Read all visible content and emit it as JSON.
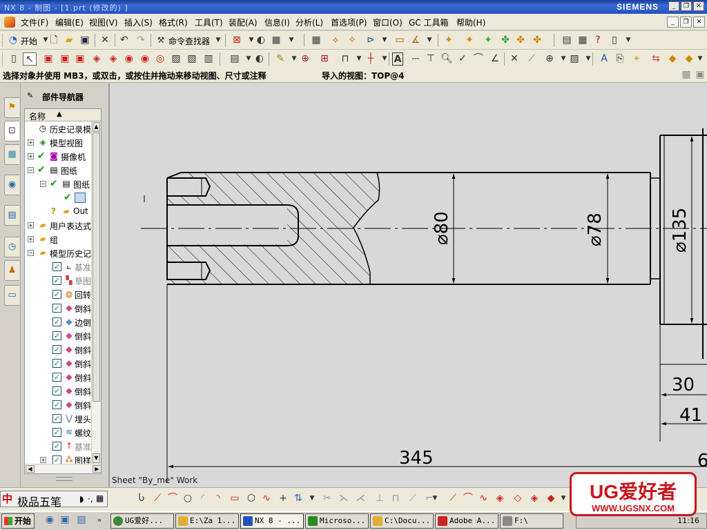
{
  "window": {
    "title": "NX 8 - 制图 - [1.prt (修改的) ]",
    "brand": "SIEMENS",
    "controls": [
      "_",
      "❐",
      "✕"
    ]
  },
  "menubar": {
    "items": [
      "文件(F)",
      "编辑(E)",
      "视图(V)",
      "插入(S)",
      "格式(R)",
      "工具(T)",
      "装配(A)",
      "信息(I)",
      "分析(L)",
      "首选项(P)",
      "窗口(O)",
      "GC 工具箱",
      "帮助(H)"
    ],
    "doc_controls": [
      "_",
      "❐",
      "✕"
    ]
  },
  "toolbar1": {
    "start_label": "开始",
    "cmd_finder_label": "命令查找器"
  },
  "status": {
    "prompt": "选择对象并使用 MB3，或双击，或按住并拖动来移动视图、尺寸或注释",
    "imported_view": "导入的视图：TOP@4"
  },
  "navigator": {
    "title": "部件导航器",
    "column_name": "名称",
    "rows": [
      {
        "label": "历史记录模",
        "icon": "clock"
      },
      {
        "label": "模型视图",
        "icon": "cube"
      },
      {
        "label": "摄像机",
        "icon": "camera"
      },
      {
        "label": "图纸",
        "icon": "sheet"
      },
      {
        "label": "图纸",
        "icon": "sheet"
      },
      {
        "label": "",
        "icon": "view"
      },
      {
        "label": "Out",
        "icon": "folder"
      },
      {
        "label": "用户表达式",
        "icon": "folder"
      },
      {
        "label": "组",
        "icon": "folder"
      },
      {
        "label": "模型历史记",
        "icon": "folder"
      },
      {
        "label": "基准",
        "icon": "datum"
      },
      {
        "label": "草图",
        "icon": "sketch"
      },
      {
        "label": "回转",
        "icon": "revolve"
      },
      {
        "label": "倒斜",
        "icon": "chamfer"
      },
      {
        "label": "边倒",
        "icon": "blend"
      },
      {
        "label": "倒斜",
        "icon": "chamfer"
      },
      {
        "label": "倒斜",
        "icon": "chamfer"
      },
      {
        "label": "倒斜",
        "icon": "chamfer"
      },
      {
        "label": "倒斜",
        "icon": "chamfer"
      },
      {
        "label": "倒斜",
        "icon": "chamfer"
      },
      {
        "label": "倒斜",
        "icon": "chamfer"
      },
      {
        "label": "埋头",
        "icon": "hole"
      },
      {
        "label": "螺纹",
        "icon": "thread"
      },
      {
        "label": "基准",
        "icon": "datum"
      },
      {
        "label": "图样",
        "icon": "pattern"
      }
    ]
  },
  "drawing": {
    "dimensions": [
      "⌀80",
      "⌀78",
      "⌀135",
      "30",
      "41",
      "345",
      "6"
    ],
    "sheet_label": "Sheet \"By_me\" Work"
  },
  "ime": {
    "name": "极品五笔"
  },
  "taskbar": {
    "start": "开始",
    "buttons": [
      "UG爱好...",
      "E:\\Za 1...",
      "NX 8 - ...",
      "Microso...",
      "C:\\Docu...",
      "Adobe A...",
      "F:\\"
    ],
    "clock": "11:16"
  },
  "watermark": {
    "title": "UG爱好者",
    "url": "WWW.UGSNX.COM"
  },
  "colors": {
    "accent": "#2350c0",
    "watermark": "#c8161d",
    "canvas": "#d8d8d8"
  }
}
